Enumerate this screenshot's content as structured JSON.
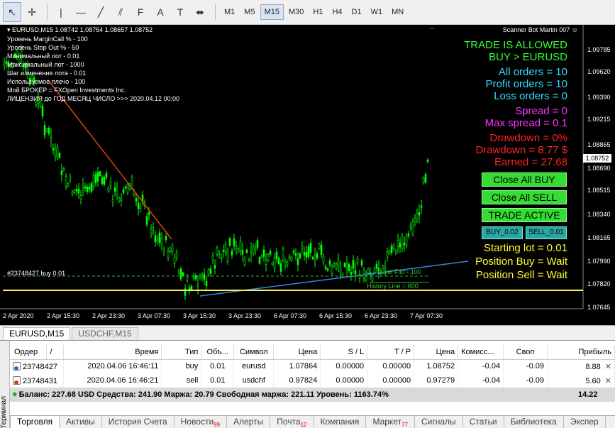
{
  "toolbar": {
    "tools": [
      {
        "name": "cursor-icon",
        "glyph": "↖"
      },
      {
        "name": "crosshair-icon",
        "glyph": "✛"
      },
      {
        "name": "vertical-line-icon",
        "glyph": "|"
      },
      {
        "name": "horizontal-line-icon",
        "glyph": "—"
      },
      {
        "name": "trendline-icon",
        "glyph": "╱"
      },
      {
        "name": "equidistant-channel-icon",
        "glyph": "⫽"
      },
      {
        "name": "fibonacci-icon",
        "glyph": "F"
      },
      {
        "name": "text-icon",
        "glyph": "A"
      },
      {
        "name": "text-label-icon",
        "glyph": "T"
      },
      {
        "name": "arrows-icon",
        "glyph": "⬌"
      }
    ],
    "timeframes": [
      "M1",
      "M5",
      "M15",
      "M30",
      "H1",
      "H4",
      "D1",
      "W1",
      "MN"
    ],
    "active_timeframe": "M15"
  },
  "chart": {
    "symbol_line": "EURUSD,M15  1.08742 1.08754 1.08657 1.08752",
    "info_lines": [
      "Уровень MarginCall % -  100",
      "Уровень Stop Out % -  50",
      "Минимальный лот -  0.01",
      "Максимальный лот -  1000",
      "Шаг изменения лота -  0.01",
      "Используемое плечо -  100",
      "Мой БРОКЕР = FXOpen Investments Inc.",
      "ЛИЦЕНЗИЯ до ГОД  МЕСЯЦ  ЧИСЛО >>> 2020.04.12 00:00"
    ],
    "expert_name": "Scanner Bot Martin 007",
    "status": {
      "trade_allowed": "TRADE IS ALLOWED",
      "direction": "BUY > EURUSD",
      "all_orders": "All orders = 10",
      "profit_orders": "Profit orders = 10",
      "loss_orders": "Loss orders = 0",
      "spread": "Spread =  0",
      "max_spread": "Max spread = 0.1",
      "drawdown_pct": "Drawdown  = 0%",
      "drawdown_usd": "Drawdown = 8.77 $",
      "earned": "Earned = 27.68",
      "starting_lot": "Starting lot = 0.01",
      "position_buy": "Position Buy  = Wait",
      "position_sell": "Position Sell = Wait"
    },
    "buttons": {
      "close_all_buy": "Close All BUY",
      "close_all_sell": "Close All SELL",
      "trade_active": "TRADE ACTIVE",
      "buy_lot": "BUY_0.02",
      "sell_lot": "SELL_0.01"
    },
    "line_labels": {
      "order": "#23748427 buy 0.01",
      "level_filter": "Level Filtr= 100",
      "history_line": "History Line = 600"
    },
    "current_price": "1.08752",
    "price_axis": [
      "1.09785",
      "1.09620",
      "1.09390",
      "1.09215",
      "1.09040",
      "1.08865",
      "1.08690",
      "1.08515",
      "1.08340",
      "1.08165",
      "1.07990",
      "1.07820",
      "1.07645"
    ],
    "time_axis": [
      "2 Apr 2020",
      "2 Apr 15:30",
      "2 Apr 23:30",
      "3 Apr 07:30",
      "3 Apr 15:30",
      "3 Apr 23:30",
      "6 Apr 07:30",
      "6 Apr 15:30",
      "6 Apr 23:30",
      "7 Apr 07:30"
    ]
  },
  "symbol_tabs": [
    {
      "label": "EURUSD,M15",
      "active": true
    },
    {
      "label": "USDCHF,M15",
      "active": false
    }
  ],
  "terminal": {
    "side_label": "Терминал",
    "columns": [
      "Ордер",
      "/",
      "Время",
      "Тип",
      "Объ...",
      "Символ",
      "Цена",
      "S / L",
      "T / P",
      "Цена",
      "Комисс...",
      "Своп",
      "Прибыль"
    ],
    "rows": [
      {
        "order": "23748427",
        "time": "2020.04.06 16:46:11",
        "type": "buy",
        "volume": "0.01",
        "symbol": "eurusd",
        "price": "1.07864",
        "sl": "0.00000",
        "tp": "0.00000",
        "cur_price": "1.08752",
        "commission": "-0.04",
        "swap": "-0.09",
        "profit": "8.88"
      },
      {
        "order": "23748431",
        "time": "2020.04.06 16:46:21",
        "type": "sell",
        "volume": "0.01",
        "symbol": "usdchf",
        "price": "0.97824",
        "sl": "0.00000",
        "tp": "0.00000",
        "cur_price": "0.97279",
        "commission": "-0.04",
        "swap": "-0.09",
        "profit": "5.60"
      }
    ],
    "balance_line": "Баланс: 227.68 USD  Средства: 241.90  Маржа: 20.79  Свободная маржа: 221.11  Уровень: 1163.74%",
    "balance_total": "14.22",
    "tabs": [
      {
        "label": "Торговля",
        "badge": ""
      },
      {
        "label": "Активы",
        "badge": ""
      },
      {
        "label": "История Счета",
        "badge": ""
      },
      {
        "label": "Новости",
        "badge": "99"
      },
      {
        "label": "Алерты",
        "badge": ""
      },
      {
        "label": "Почта",
        "badge": "12"
      },
      {
        "label": "Компания",
        "badge": ""
      },
      {
        "label": "Маркет",
        "badge": "77"
      },
      {
        "label": "Сигналы",
        "badge": ""
      },
      {
        "label": "Статьи",
        "badge": ""
      },
      {
        "label": "Библиотека",
        "badge": ""
      },
      {
        "label": "Экспер",
        "badge": ""
      }
    ]
  },
  "colors": {
    "candle": "#00ff00",
    "green_text": "#33ff33",
    "cyan_text": "#33ddff",
    "magenta_text": "#ff33ff",
    "red_text": "#ff2222",
    "yellow_text": "#ffff33",
    "history_line": "#ffee55",
    "trend_red": "#dd4411",
    "trend_blue": "#3388dd"
  }
}
